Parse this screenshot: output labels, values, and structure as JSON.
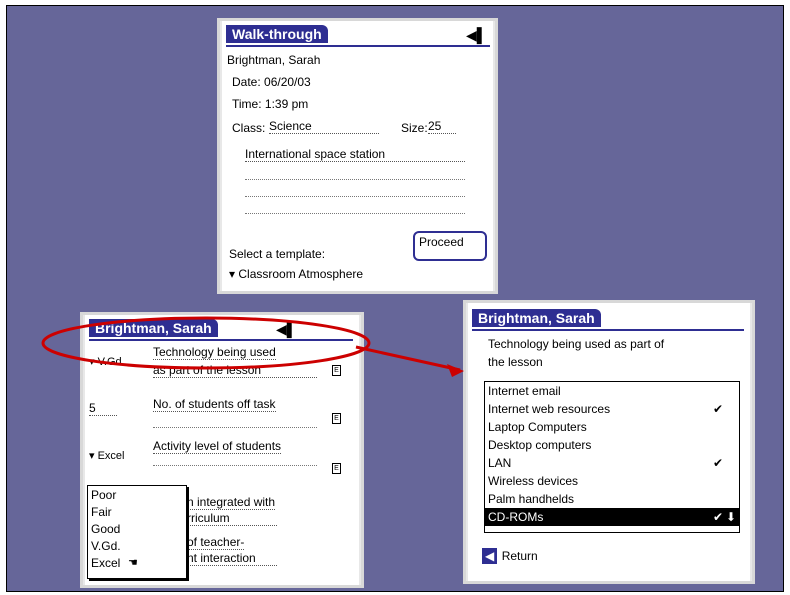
{
  "top": {
    "title": "Walk-through",
    "name": "Brightman, Sarah",
    "date_label": "Date: 06/20/03",
    "time_label": "Time: 1:39 pm",
    "class_label": "Class:",
    "class_value": "Science",
    "size_label": "Size:",
    "size_value": "25",
    "note": "International space station",
    "template_label": "Select a template:",
    "template_value": "▾ Classroom Atmosphere",
    "proceed_button": "Proceed"
  },
  "left": {
    "title": "Brightman, Sarah",
    "items": [
      {
        "left": "▾ V.Gd.",
        "line1": "Technology being used",
        "line2": "as part of the lesson"
      },
      {
        "left": "5",
        "line1": "No. of students off task",
        "line2": ""
      },
      {
        "left": "▾ Excel",
        "line1": "Activity level of students",
        "line2": ""
      },
      {
        "left": "",
        "line1": "n integrated with",
        "line2": "rriculum"
      },
      {
        "left": "",
        "line1": "of teacher-",
        "line2": "nt interaction"
      }
    ],
    "dropdown_options": [
      "Poor",
      "Fair",
      "Good",
      "V.Gd.",
      "Excel"
    ],
    "box_glyph": "E"
  },
  "right": {
    "title": "Brightman, Sarah",
    "question_line1": "Technology being used as part of",
    "question_line2": "the lesson",
    "options": [
      {
        "label": "Internet email",
        "checked": false
      },
      {
        "label": "Internet web resources",
        "checked": true
      },
      {
        "label": "Laptop Computers",
        "checked": false
      },
      {
        "label": "Desktop computers",
        "checked": false
      },
      {
        "label": "LAN",
        "checked": true
      },
      {
        "label": "Wireless devices",
        "checked": false
      },
      {
        "label": "Palm handhelds",
        "checked": false
      },
      {
        "label": "CD-ROMs",
        "checked": true
      }
    ],
    "check_glyph": "✔",
    "return_label": "Return"
  },
  "colors": {
    "background": "#666699",
    "accent": "#2e2e92",
    "highlight": "#cc0000"
  }
}
